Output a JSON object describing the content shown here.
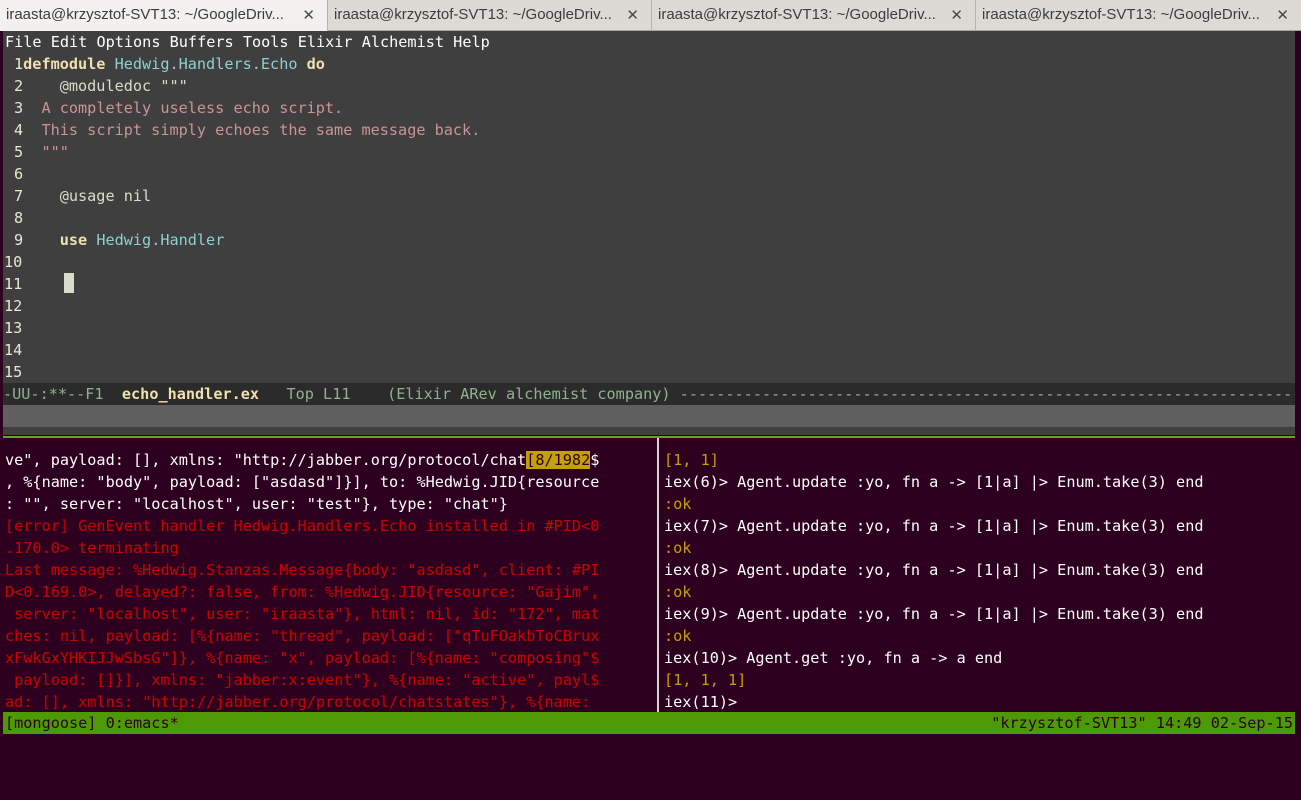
{
  "tabs": [
    {
      "label": "iraasta@krzysztof-SVT13: ~/GoogleDriv..."
    },
    {
      "label": "iraasta@krzysztof-SVT13: ~/GoogleDriv..."
    },
    {
      "label": "iraasta@krzysztof-SVT13: ~/GoogleDriv..."
    },
    {
      "label": "iraasta@krzysztof-SVT13: ~/GoogleDriv..."
    }
  ],
  "tab_close_glyph": "✕",
  "menu": [
    "File",
    "Edit",
    "Options",
    "Buffers",
    "Tools",
    "Elixir",
    "Alchemist",
    "Help"
  ],
  "code": {
    "l1_num": "1",
    "l1_kw": "defmodule",
    "l1_mod": "Hedwig.Handlers.Echo",
    "l1_do": "do",
    "l2_num": "2",
    "l2_text": "@moduledoc \"\"\"",
    "l3_num": "3",
    "l3_text": "A completely useless echo script.",
    "l4_num": "4",
    "l4_text": "This script simply echoes the same message back.",
    "l5_num": "5",
    "l5_text": "\"\"\"",
    "l6_num": "6",
    "l7_num": "7",
    "l7_text": "@usage nil",
    "l8_num": "8",
    "l9_num": "9",
    "l9_kw": "use",
    "l9_mod": "Hedwig.Handler",
    "l10_num": "10",
    "l11_num": "11",
    "l12_num": "12",
    "l13_num": "13",
    "l14_num": "14",
    "l15_num": "15"
  },
  "modeline": {
    "prefix": "-UU-:**--F1",
    "buffer": "echo_handler.ex",
    "position": "Top L11",
    "modes": "(Elixir ARev alchemist company)",
    "fill": " -----------------------------------------------------------------------------------"
  },
  "left_pane": {
    "l1a": "ve\", payload: [], xmlns: \"http://jabber.org/protocol/chat",
    "l1_hl": "[8/1982",
    "l1b": "$",
    "l2": ", %{name: \"body\", payload: [\"asdasd\"]}], to: %Hedwig.JID{resource",
    "l3": ": \"\", server: \"localhost\", user: \"test\"}, type: \"chat\"}",
    "l4": "[error] GenEvent handler Hedwig.Handlers.Echo installed in #PID<0",
    "l5": ".170.0> terminating",
    "l6": "Last message: %Hedwig.Stanzas.Message{body: \"asdasd\", client: #PI",
    "l7": "D<0.169.0>, delayed?: false, from: %Hedwig.JID{resource: \"Gajim\",",
    "l8": " server: \"localhost\", user: \"iraasta\"}, html: nil, id: \"172\", mat",
    "l9": "ches: nil, payload: [%{name: \"thread\", payload: [\"qTuFOakbToCBrux",
    "l10": "xFwkGxYHKIJJwSbsG\"]}, %{name: \"x\", payload: [%{name: \"composing\"$",
    "l11": " payload: []}], xmlns: \"jabber:x:event\"}, %{name: \"active\", payl$",
    "l12": "ad: [], xmlns: \"http://jabber.org/protocol/chatstates\"}, %{name:"
  },
  "right_pane": {
    "l1": "[1, 1]",
    "l2": "iex(6)> Agent.update :yo, fn a -> [1|a] |> Enum.take(3) end",
    "l3": ":ok",
    "l4": "iex(7)> Agent.update :yo, fn a -> [1|a] |> Enum.take(3) end",
    "l5": ":ok",
    "l6": "iex(8)> Agent.update :yo, fn a -> [1|a] |> Enum.take(3) end",
    "l7": ":ok",
    "l8": "iex(9)> Agent.update :yo, fn a -> [1|a] |> Enum.take(3) end",
    "l9": ":ok",
    "l10": "iex(10)> Agent.get :yo, fn a -> a end",
    "l11": "[1, 1, 1]",
    "l12": "iex(11)>"
  },
  "tmux_status": {
    "left": "[mongoose] 0:emacs*",
    "right": "\"krzysztof-SVT13\" 14:49 02-Sep-15"
  }
}
